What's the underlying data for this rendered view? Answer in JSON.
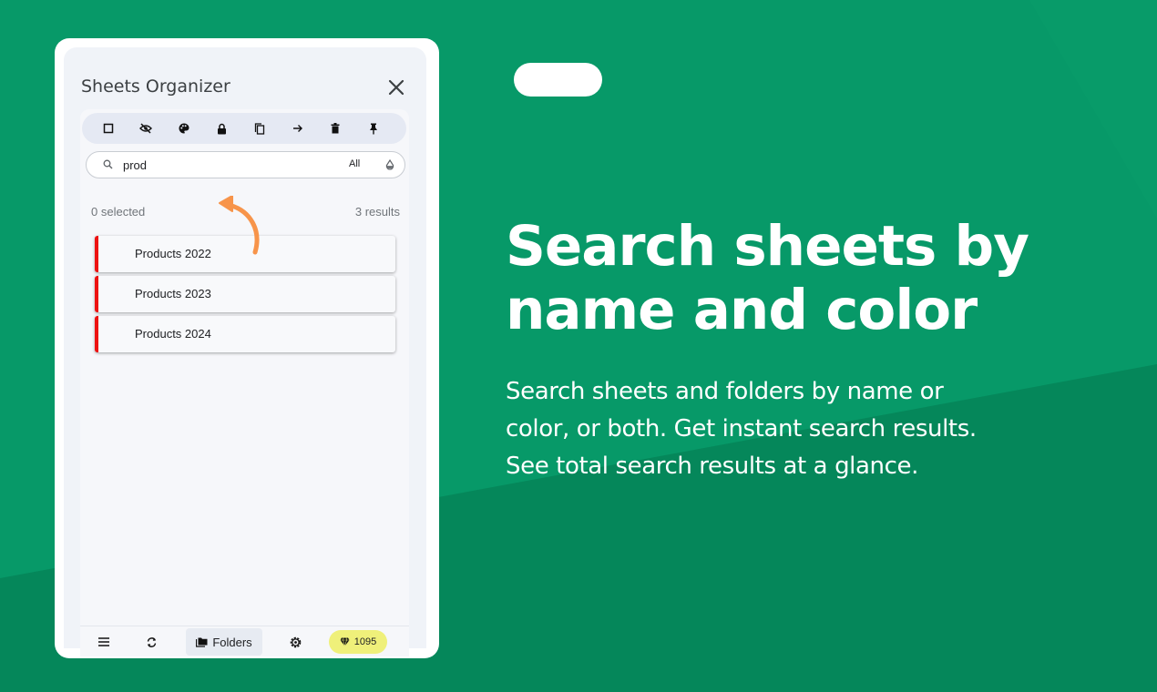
{
  "colors": {
    "background": "#079968",
    "background_shade": "#05875a",
    "accent_orange": "#f7944a",
    "item_marker": "#ee1111",
    "gems_badge": "#eff07a"
  },
  "panel": {
    "title": "Sheets Organizer",
    "toolbar_icons": [
      "square-outline-icon",
      "eye-off-icon",
      "palette-icon",
      "lock-icon",
      "copy-icon",
      "arrow-right-icon",
      "trash-icon",
      "pin-icon"
    ],
    "search": {
      "value": "prod",
      "filter_label": "All"
    },
    "selected_count": "0 selected",
    "results_count": "3 results",
    "items": [
      {
        "label": "Products 2022"
      },
      {
        "label": "Products 2023"
      },
      {
        "label": "Products 2024"
      }
    ],
    "bottom_bar": {
      "folders_label": "Folders",
      "gems_count": "1095"
    }
  },
  "promo": {
    "headline_line1": "Search sheets by",
    "headline_line2": "name and color",
    "desc_line1": "Search sheets and folders by name or",
    "desc_line2": "color, or both. Get instant search results.",
    "desc_line3": "See total search results at a glance."
  }
}
